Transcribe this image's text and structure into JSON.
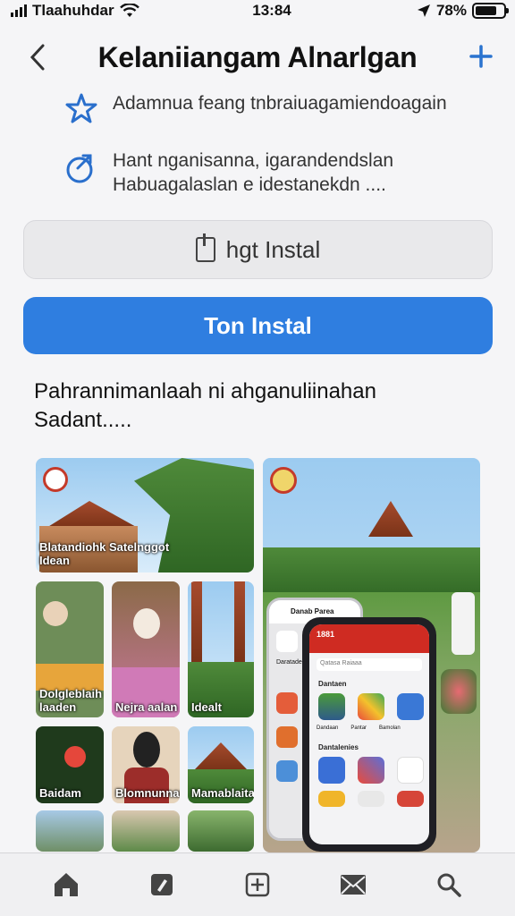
{
  "status_bar": {
    "carrier": "Tlaahuhdar",
    "time": "13:84",
    "battery": "78%",
    "battery_level": 0.78
  },
  "nav": {
    "title": "Kelaniiangam Alnarlgan",
    "back_icon": "chevron-left-icon",
    "add_icon": "plus-icon"
  },
  "features": [
    {
      "icon": "star-icon",
      "text_lines": [
        "Adamnua feang tnbraiuagamiendoagain"
      ]
    },
    {
      "icon": "share-icon",
      "text_lines": [
        "Hant nganisanna, igarandendslan",
        "Habuagalaslan e idestanekdn ...."
      ]
    }
  ],
  "buttons": {
    "secondary_label": "hgt Instal",
    "primary_label": "Ton Instal"
  },
  "description": {
    "line1": "Pahrannimanlaah ni ahganuliinahan",
    "line2": "Sadant....."
  },
  "gallery": {
    "hero_caption_line1": "Blatandiohk Satelnggot",
    "hero_caption_line2": "Idean",
    "tiles": [
      {
        "line1": "Dolgleblaih",
        "line2": "laaden"
      },
      {
        "line1": "Nejra aalan",
        "line2": ""
      },
      {
        "line1": "Idealt",
        "line2": ""
      },
      {
        "line1": "Baidam",
        "line2": ""
      },
      {
        "line1": "Blomnunnara",
        "line2": ""
      },
      {
        "line1": "Mamablaitan",
        "line2": ""
      }
    ]
  },
  "phone": {
    "left_header": "Danab Parea",
    "left_label": "Daratadea",
    "header": "1881",
    "search_placeholder": "Qatasa Raiaaa",
    "section1": "Dantaen",
    "section2": "Dantalenies",
    "app_labels": [
      "Dandaan",
      "Pantar",
      "Bamolan"
    ]
  },
  "tab_bar": {
    "tabs": [
      "home-icon",
      "pencil-icon",
      "add-box-icon",
      "mail-icon",
      "search-icon"
    ]
  }
}
